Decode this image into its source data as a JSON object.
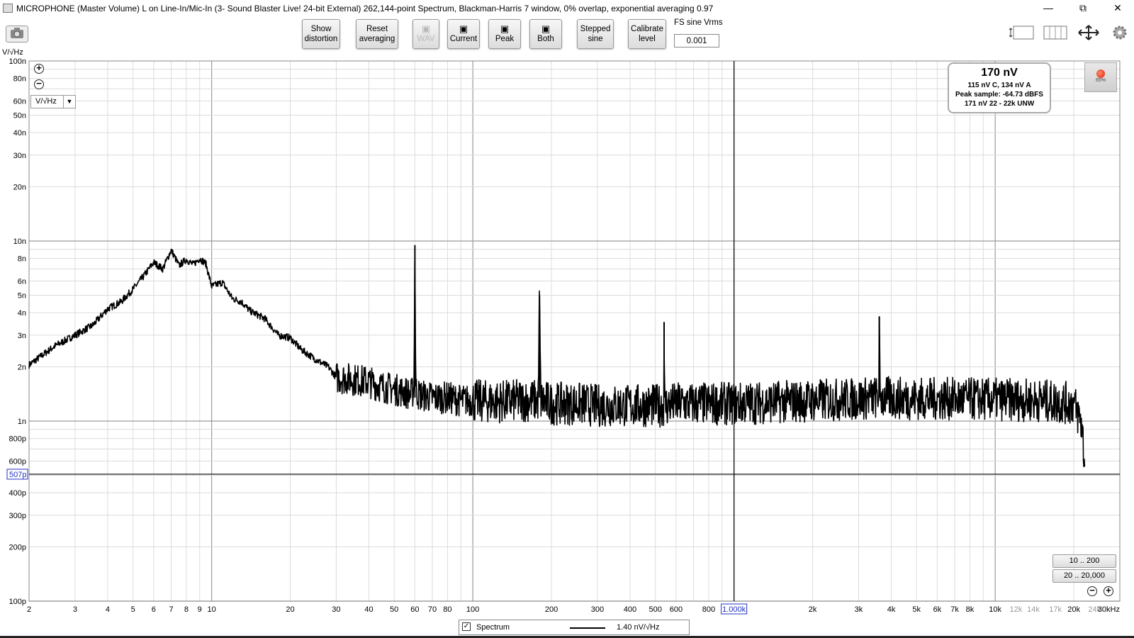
{
  "window": {
    "title": "MICROPHONE (Master Volume) L on Line-In/Mic-In (3- Sound Blaster Live! 24-bit External) 262,144-point Spectrum, Blackman-Harris 7 window, 0% overlap, exponential averaging 0.97",
    "minimize": "—",
    "restore": "⧉",
    "close": "✕"
  },
  "toolbar": {
    "show_distortion": [
      "Show",
      "distortion"
    ],
    "reset_averaging": [
      "Reset",
      "averaging"
    ],
    "wav": "WAV",
    "current": "Current",
    "peak": "Peak",
    "both": "Both",
    "stepped_sine": [
      "Stepped",
      "sine"
    ],
    "calibrate_level": [
      "Calibrate",
      "level"
    ],
    "fs_label": "FS sine Vrms",
    "fs_value": "0.001"
  },
  "units": {
    "axis_units": "V/√Hz",
    "selector": "V/√Hz"
  },
  "readout": {
    "main": "170 nV",
    "line1": "115 nV C, 134 nV A",
    "line2": "Peak sample: -64.73 dBFS",
    "line3": "171 nV 22 - 22k UNW"
  },
  "rec_level": "65%",
  "ranges": {
    "range1": "10 .. 200",
    "range2": "20 .. 20,000"
  },
  "legend": {
    "name": "Spectrum",
    "value": "1.40 nV/√Hz"
  },
  "chart_data": {
    "type": "line",
    "xscale": "log",
    "yscale": "log",
    "xlim": [
      2,
      30000
    ],
    "ylim": [
      1e-10,
      1e-07
    ],
    "ylabel": "V/√Hz",
    "grid": true,
    "y_ticks": [
      {
        "v": 1e-07,
        "l": "100n"
      },
      {
        "v": 8e-08,
        "l": "80n"
      },
      {
        "v": 6e-08,
        "l": "60n"
      },
      {
        "v": 5e-08,
        "l": "50n"
      },
      {
        "v": 4e-08,
        "l": "40n"
      },
      {
        "v": 3e-08,
        "l": "30n"
      },
      {
        "v": 2e-08,
        "l": "20n"
      },
      {
        "v": 1e-08,
        "l": "10n"
      },
      {
        "v": 8e-09,
        "l": "8n"
      },
      {
        "v": 6e-09,
        "l": "6n"
      },
      {
        "v": 5e-09,
        "l": "5n"
      },
      {
        "v": 4e-09,
        "l": "4n"
      },
      {
        "v": 3e-09,
        "l": "3n"
      },
      {
        "v": 2e-09,
        "l": "2n"
      },
      {
        "v": 1e-09,
        "l": "1n"
      },
      {
        "v": 8e-10,
        "l": "800p"
      },
      {
        "v": 6e-10,
        "l": "600p"
      },
      {
        "v": 4e-10,
        "l": "400p"
      },
      {
        "v": 3e-10,
        "l": "300p"
      },
      {
        "v": 2e-10,
        "l": "200p"
      },
      {
        "v": 1e-10,
        "l": "100p"
      }
    ],
    "x_ticks": [
      {
        "v": 2,
        "l": "2"
      },
      {
        "v": 3,
        "l": "3"
      },
      {
        "v": 4,
        "l": "4"
      },
      {
        "v": 5,
        "l": "5"
      },
      {
        "v": 6,
        "l": "6"
      },
      {
        "v": 7,
        "l": "7"
      },
      {
        "v": 8,
        "l": "8"
      },
      {
        "v": 9,
        "l": "9"
      },
      {
        "v": 10,
        "l": "10"
      },
      {
        "v": 20,
        "l": "20"
      },
      {
        "v": 30,
        "l": "30"
      },
      {
        "v": 40,
        "l": "40"
      },
      {
        "v": 50,
        "l": "50"
      },
      {
        "v": 60,
        "l": "60"
      },
      {
        "v": 70,
        "l": "70"
      },
      {
        "v": 80,
        "l": "80"
      },
      {
        "v": 100,
        "l": "100"
      },
      {
        "v": 200,
        "l": "200"
      },
      {
        "v": 300,
        "l": "300"
      },
      {
        "v": 400,
        "l": "400"
      },
      {
        "v": 500,
        "l": "500"
      },
      {
        "v": 600,
        "l": "600"
      },
      {
        "v": 800,
        "l": "800"
      },
      {
        "v": 2000,
        "l": "2k"
      },
      {
        "v": 3000,
        "l": "3k"
      },
      {
        "v": 4000,
        "l": "4k"
      },
      {
        "v": 5000,
        "l": "5k"
      },
      {
        "v": 6000,
        "l": "6k"
      },
      {
        "v": 7000,
        "l": "7k"
      },
      {
        "v": 8000,
        "l": "8k"
      },
      {
        "v": 10000,
        "l": "10k",
        "faint": false
      },
      {
        "v": 12000,
        "l": "12k",
        "faint": true
      },
      {
        "v": 14000,
        "l": "14k",
        "faint": true
      },
      {
        "v": 17000,
        "l": "17k",
        "faint": true
      },
      {
        "v": 20000,
        "l": "20k"
      },
      {
        "v": 24000,
        "l": "24k",
        "faint": true
      },
      {
        "v": 30000,
        "l": "30kHz"
      }
    ],
    "cursor_x": {
      "v": 1000,
      "l": "1.000k"
    },
    "cursor_y": {
      "v": 5.07e-10,
      "l": "507p"
    },
    "series": [
      {
        "name": "Spectrum",
        "x": [
          2,
          2.5,
          3,
          3.5,
          4,
          4.5,
          5,
          5.5,
          6,
          6.5,
          7,
          7.5,
          8,
          8.5,
          9,
          9.5,
          10,
          11,
          12,
          13,
          14,
          16,
          18,
          20,
          22,
          25,
          28,
          30,
          35,
          40,
          45,
          50,
          55,
          58,
          59.5,
          60,
          60.5,
          62,
          70,
          80,
          90,
          100,
          120,
          150,
          178,
          180,
          182,
          200,
          250,
          300,
          400,
          500,
          538,
          540,
          542,
          600,
          800,
          1000,
          1500,
          2000,
          3000,
          3500,
          3580,
          3600,
          3620,
          3700,
          5000,
          7000,
          10000,
          15000,
          20000,
          21500,
          22000
        ],
        "y": [
          2.05e-09,
          2.6e-09,
          3e-09,
          3.4e-09,
          4.2e-09,
          4.6e-09,
          5.4e-09,
          6.4e-09,
          7.6e-09,
          7e-09,
          8.9e-09,
          7.3e-09,
          7.9e-09,
          7.4e-09,
          8e-09,
          7.5e-09,
          5.6e-09,
          5.9e-09,
          4.8e-09,
          4.6e-09,
          4.1e-09,
          3.7e-09,
          3e-09,
          2.9e-09,
          2.5e-09,
          2.2e-09,
          2e-09,
          1.75e-09,
          1.7e-09,
          1.65e-09,
          1.55e-09,
          1.5e-09,
          1.45e-09,
          1.4e-09,
          1.5e-09,
          9.5e-09,
          1.5e-09,
          1.4e-09,
          1.35e-09,
          1.35e-09,
          1.3e-09,
          1.3e-09,
          1.28e-09,
          1.3e-09,
          1.3e-09,
          5e-09,
          1.3e-09,
          1.25e-09,
          1.25e-09,
          1.22e-09,
          1.22e-09,
          1.22e-09,
          1.22e-09,
          3.55e-09,
          1.22e-09,
          1.25e-09,
          1.25e-09,
          1.25e-09,
          1.28e-09,
          1.3e-09,
          1.33e-09,
          1.35e-09,
          1.35e-09,
          3.8e-09,
          1.35e-09,
          1.35e-09,
          1.33e-09,
          1.33e-09,
          1.32e-09,
          1.3e-09,
          1.25e-09,
          9.5e-10,
          5.6e-10
        ]
      }
    ]
  }
}
